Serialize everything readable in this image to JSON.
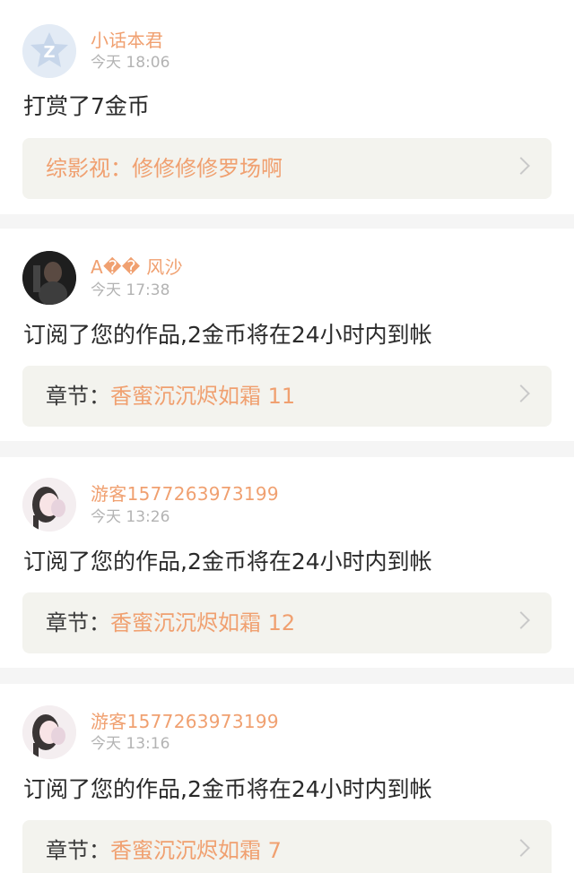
{
  "colors": {
    "accent": "#f0a070",
    "text": "#2a2a2a",
    "muted": "#b3b3b3",
    "box_bg": "#f3f3ee",
    "divider": "#f5f5f5"
  },
  "entries": [
    {
      "username": "小话本君",
      "time": "今天 18:06",
      "message": "打赏了7金币",
      "work_prefix": "综影视：",
      "work_title": "修修修修罗场啊",
      "avatar_icon": "q-logo-avatar"
    },
    {
      "username": "A�� 风沙",
      "time": "今天 17:38",
      "message": "订阅了您的作品,2金币将在24小时内到帐",
      "work_prefix": "章节：",
      "work_title": "香蜜沉沉烬如霜 11",
      "avatar_icon": "photo-avatar"
    },
    {
      "username": "游客1577263973199",
      "time": "今天 13:26",
      "message": "订阅了您的作品,2金币将在24小时内到帐",
      "work_prefix": "章节：",
      "work_title": "香蜜沉沉烬如霜 12",
      "avatar_icon": "girl-avatar"
    },
    {
      "username": "游客1577263973199",
      "time": "今天 13:16",
      "message": "订阅了您的作品,2金币将在24小时内到帐",
      "work_prefix": "章节：",
      "work_title": "香蜜沉沉烬如霜 7",
      "avatar_icon": "girl-avatar"
    }
  ]
}
